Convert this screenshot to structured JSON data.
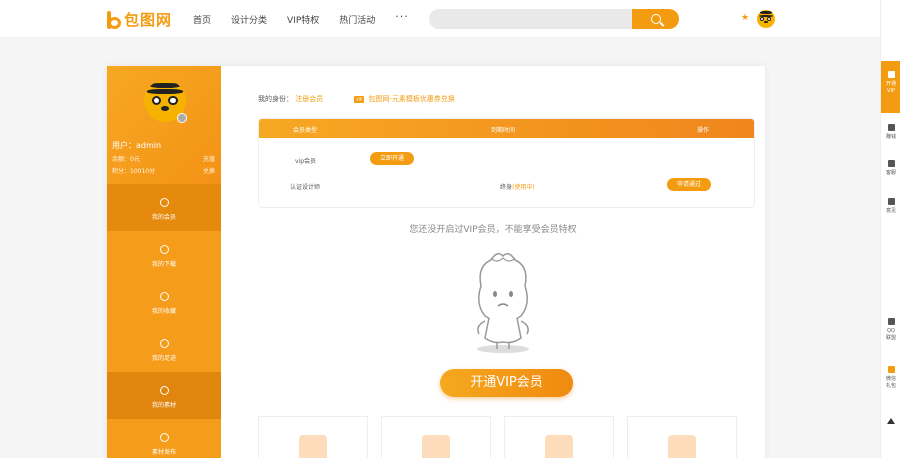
{
  "header": {
    "logo_text": "包图网",
    "nav": [
      "首页",
      "设计分类",
      "VIP特权",
      "热门活动"
    ],
    "more": "···",
    "crown": "★"
  },
  "right_bar": [
    {
      "label": "开通\nVIP",
      "icon": "crown-icon"
    },
    {
      "label": "赚钱",
      "icon": "money-icon"
    },
    {
      "label": "客服",
      "icon": "service-icon"
    },
    {
      "label": "意见",
      "icon": "feedback-icon"
    },
    {
      "label": "QQ\n联盟",
      "icon": "qq-icon"
    },
    {
      "label": "微信\n礼包",
      "icon": "gift-icon"
    },
    {
      "label": "",
      "icon": "back-to-top-icon"
    }
  ],
  "sidebar": {
    "username": "用户：admin",
    "balance_label": "余额：0元",
    "balance_action": "充值",
    "points_label": "积分：10010分",
    "points_action": "兑换",
    "menu": [
      "我的会员",
      "我的下载",
      "我的收藏",
      "我的足迹",
      "我的素材",
      "素材发布"
    ]
  },
  "main": {
    "identity_label": "我的身份：",
    "identity_value": "注册会员",
    "coupon_tag": "VIP",
    "coupon_text": "包图网-元素模板优惠券兑换",
    "table": {
      "headers": [
        "会员类型",
        "到期时间",
        "操作"
      ],
      "rows": [
        {
          "type": "vip会员",
          "expire": "",
          "action": "立即开通"
        },
        {
          "type": "认证设计师",
          "expire": "终身",
          "expire_status": "(使用中)",
          "action": "申请通过"
        }
      ]
    },
    "notice": "您还没开启过VIP会员，不能享受会员特权",
    "cta": "开通VIP会员"
  },
  "colors": {
    "accent": "#f39c12"
  }
}
